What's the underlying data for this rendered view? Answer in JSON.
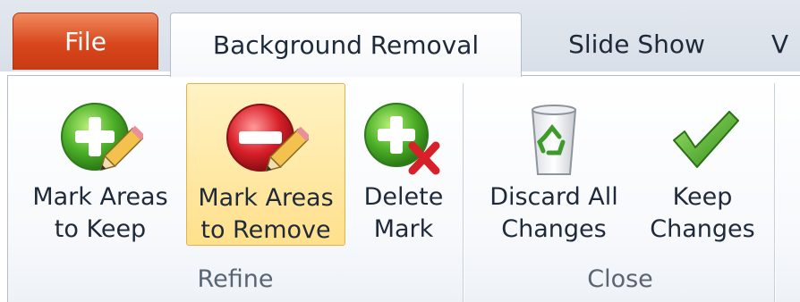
{
  "tabs": {
    "file": "File",
    "background_removal": "Background Removal",
    "slide_show": "Slide Show",
    "partial": "V"
  },
  "groups": {
    "refine": {
      "label": "Refine",
      "buttons": [
        {
          "line1": "Mark Areas",
          "line2": "to Keep",
          "icon": "mark-keep-icon"
        },
        {
          "line1": "Mark Areas",
          "line2": "to Remove",
          "icon": "mark-remove-icon"
        },
        {
          "line1": "Delete",
          "line2": "Mark",
          "icon": "delete-mark-icon"
        }
      ]
    },
    "close": {
      "label": "Close",
      "buttons": [
        {
          "line1": "Discard All",
          "line2": "Changes",
          "icon": "recycle-bin-icon"
        },
        {
          "line1": "Keep",
          "line2": "Changes",
          "icon": "checkmark-icon"
        }
      ]
    }
  },
  "colors": {
    "file_tab": "#d8461d",
    "selected_button": "#ffe08c",
    "keep_green": "#4caf28",
    "remove_red": "#d8202a"
  }
}
